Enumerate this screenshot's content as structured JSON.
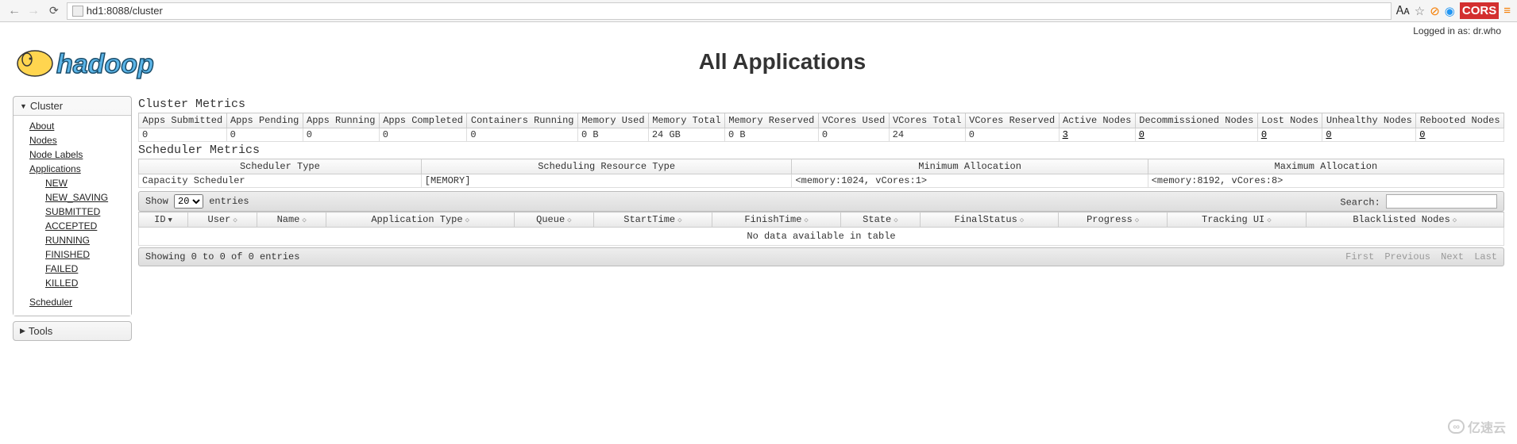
{
  "browser": {
    "url": "hd1:8088/cluster",
    "cors": "CORS"
  },
  "login": "Logged in as: dr.who",
  "title": "All Applications",
  "sidebar": {
    "cluster": {
      "header": "Cluster",
      "items": [
        "About",
        "Nodes",
        "Node Labels",
        "Applications"
      ],
      "app_states": [
        "NEW",
        "NEW_SAVING",
        "SUBMITTED",
        "ACCEPTED",
        "RUNNING",
        "FINISHED",
        "FAILED",
        "KILLED"
      ],
      "scheduler": "Scheduler"
    },
    "tools": {
      "header": "Tools"
    }
  },
  "cluster_metrics": {
    "title": "Cluster Metrics",
    "headers": [
      "Apps Submitted",
      "Apps Pending",
      "Apps Running",
      "Apps Completed",
      "Containers Running",
      "Memory Used",
      "Memory Total",
      "Memory Reserved",
      "VCores Used",
      "VCores Total",
      "VCores Reserved",
      "Active Nodes",
      "Decommissioned Nodes",
      "Lost Nodes",
      "Unhealthy Nodes",
      "Rebooted Nodes"
    ],
    "values": [
      "0",
      "0",
      "0",
      "0",
      "0",
      "0 B",
      "24 GB",
      "0 B",
      "0",
      "24",
      "0",
      "3",
      "0",
      "0",
      "0",
      "0"
    ]
  },
  "scheduler_metrics": {
    "title": "Scheduler Metrics",
    "headers": [
      "Scheduler Type",
      "Scheduling Resource Type",
      "Minimum Allocation",
      "Maximum Allocation"
    ],
    "values": [
      "Capacity Scheduler",
      "[MEMORY]",
      "<memory:1024, vCores:1>",
      "<memory:8192, vCores:8>"
    ]
  },
  "dt": {
    "show_pre": "Show",
    "show_post": "entries",
    "page_size": "20",
    "search_label": "Search:",
    "headers": [
      "ID",
      "User",
      "Name",
      "Application Type",
      "Queue",
      "StartTime",
      "FinishTime",
      "State",
      "FinalStatus",
      "Progress",
      "Tracking UI",
      "Blacklisted Nodes"
    ],
    "nodata": "No data available in table",
    "info": "Showing 0 to 0 of 0 entries",
    "paging": [
      "First",
      "Previous",
      "Next",
      "Last"
    ]
  },
  "watermark": "亿速云"
}
